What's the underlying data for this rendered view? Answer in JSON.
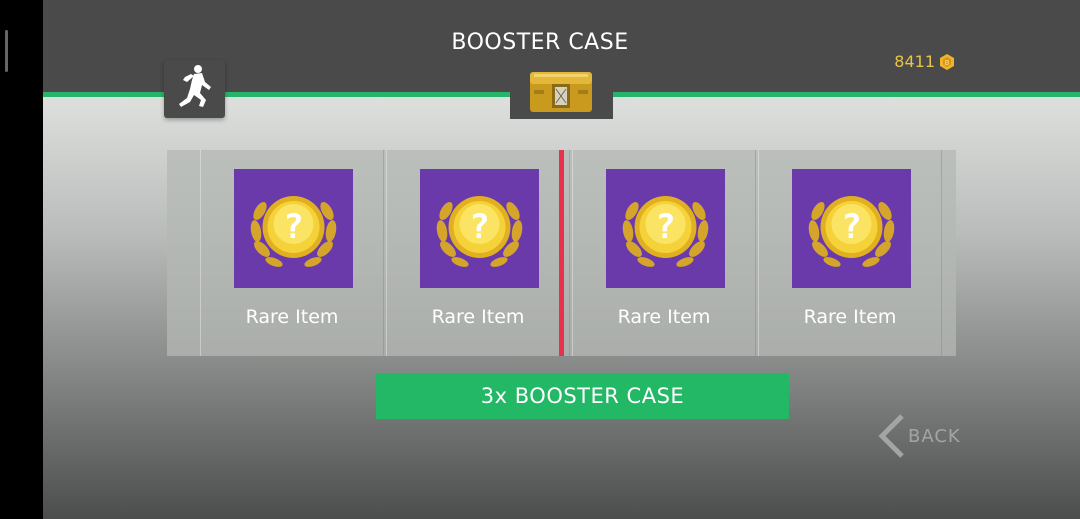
{
  "header": {
    "title": "BOOSTER CASE",
    "currency_amount": "8411",
    "currency_icon": "coin-icon"
  },
  "avatar": {
    "icon": "player-jump-icon"
  },
  "case_tab": {
    "icon": "booster-case-chest-icon"
  },
  "reel": {
    "items": [
      {
        "label": "Rare Item",
        "icon": "rare-item-laurel-question-icon"
      },
      {
        "label": "Rare Item",
        "icon": "rare-item-laurel-question-icon"
      },
      {
        "label": "Rare Item",
        "icon": "rare-item-laurel-question-icon"
      },
      {
        "label": "Rare Item",
        "icon": "rare-item-laurel-question-icon"
      }
    ]
  },
  "actions": {
    "open_label": "3x BOOSTER CASE",
    "back_label": "BACK"
  },
  "colors": {
    "accent_green": "#22b865",
    "marker_red": "#e8304f",
    "card_purple": "#6a3aab",
    "currency_gold": "#e8c547"
  }
}
